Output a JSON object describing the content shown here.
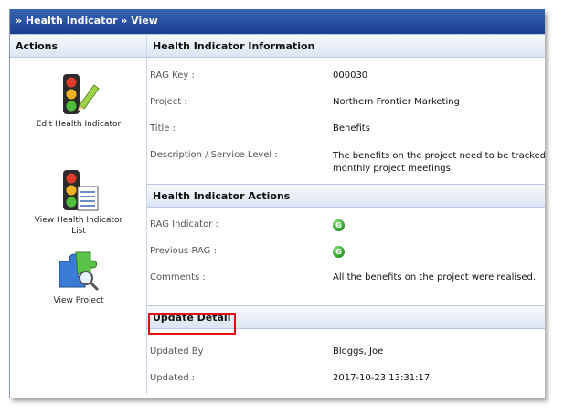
{
  "header": {
    "title": "» Health Indicator » View"
  },
  "sidebar": {
    "title": "Actions",
    "actions": [
      {
        "label": "Edit Health Indicator",
        "icon": "traffic-light-pencil-icon"
      },
      {
        "label": "View Health Indicator List",
        "icon": "traffic-light-list-icon"
      },
      {
        "label": "View Project",
        "icon": "puzzle-magnifier-icon"
      }
    ]
  },
  "info": {
    "title": "Health Indicator Information",
    "rag_key_label": "RAG Key :",
    "rag_key": "000030",
    "project_label": "Project :",
    "project": "Northern Frontier Marketing",
    "title_label": "Title :",
    "title_value": "Benefits",
    "description_label": "Description / Service Level :",
    "description": "The benefits on the project need to be tracked monthly project meetings."
  },
  "actions_section": {
    "title": "Health Indicator Actions",
    "rag_indicator_label": "RAG Indicator :",
    "rag_indicator": "G",
    "previous_rag_label": "Previous RAG :",
    "previous_rag": "G",
    "comments_label": "Comments :",
    "comments": "All the benefits on the project were realised."
  },
  "update": {
    "title": "Update Detail",
    "updated_by_label": "Updated By :",
    "updated_by": "Bloggs, Joe",
    "updated_label": "Updated :",
    "updated": "2017-10-23 13:31:17"
  },
  "colors": {
    "header": "#1f4596",
    "rag_green": "#2fa52a",
    "highlight": "#dd1111"
  }
}
